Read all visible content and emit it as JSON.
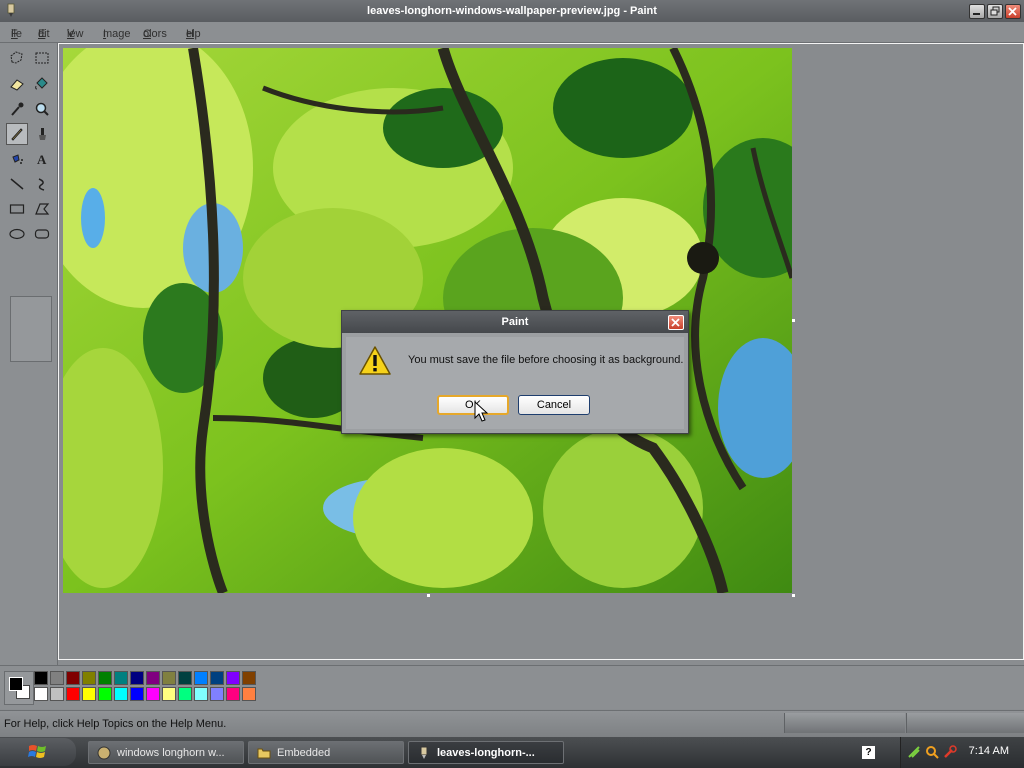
{
  "window": {
    "title": "leaves-longhorn-windows-wallpaper-preview.jpg - Paint"
  },
  "menu": {
    "items": [
      {
        "first": "F",
        "rest": "ile"
      },
      {
        "first": "E",
        "rest": "dit"
      },
      {
        "first": "V",
        "rest": "iew"
      },
      {
        "first": "I",
        "rest": "mage"
      },
      {
        "first": "C",
        "rest": "olors"
      },
      {
        "first": "H",
        "rest": "elp"
      }
    ]
  },
  "tools": [
    "free-form-select-icon",
    "select-icon",
    "eraser-icon",
    "fill-icon",
    "pick-color-icon",
    "magnifier-icon",
    "pencil-icon",
    "brush-icon",
    "airbrush-icon",
    "text-icon",
    "line-icon",
    "curve-icon",
    "rectangle-icon",
    "polygon-icon",
    "ellipse-icon",
    "rounded-rectangle-icon"
  ],
  "dialog": {
    "title": "Paint",
    "message": "You must save the file before choosing it as background.",
    "ok_label": "OK",
    "cancel_label": "Cancel"
  },
  "palette": {
    "foreground": "#000000",
    "background": "#ffffff",
    "row1": [
      "#000000",
      "#808080",
      "#800000",
      "#808000",
      "#008000",
      "#008080",
      "#000080",
      "#800080",
      "#808040",
      "#004040",
      "#0080ff",
      "#004080",
      "#8000ff",
      "#804000"
    ],
    "row2": [
      "#ffffff",
      "#c0c0c0",
      "#ff0000",
      "#ffff00",
      "#00ff00",
      "#00ffff",
      "#0000ff",
      "#ff00ff",
      "#ffff80",
      "#00ff80",
      "#80ffff",
      "#8080ff",
      "#ff0080",
      "#ff8040"
    ]
  },
  "status": {
    "help_text": "For Help, click Help Topics on the Help Menu."
  },
  "taskbar": {
    "tasks": [
      {
        "label": "windows longhorn w...",
        "active": false
      },
      {
        "label": "Embedded",
        "active": false
      },
      {
        "label": "leaves-longhorn-...",
        "active": true
      }
    ],
    "clock": "7:14 AM",
    "help_glyph": "?"
  }
}
